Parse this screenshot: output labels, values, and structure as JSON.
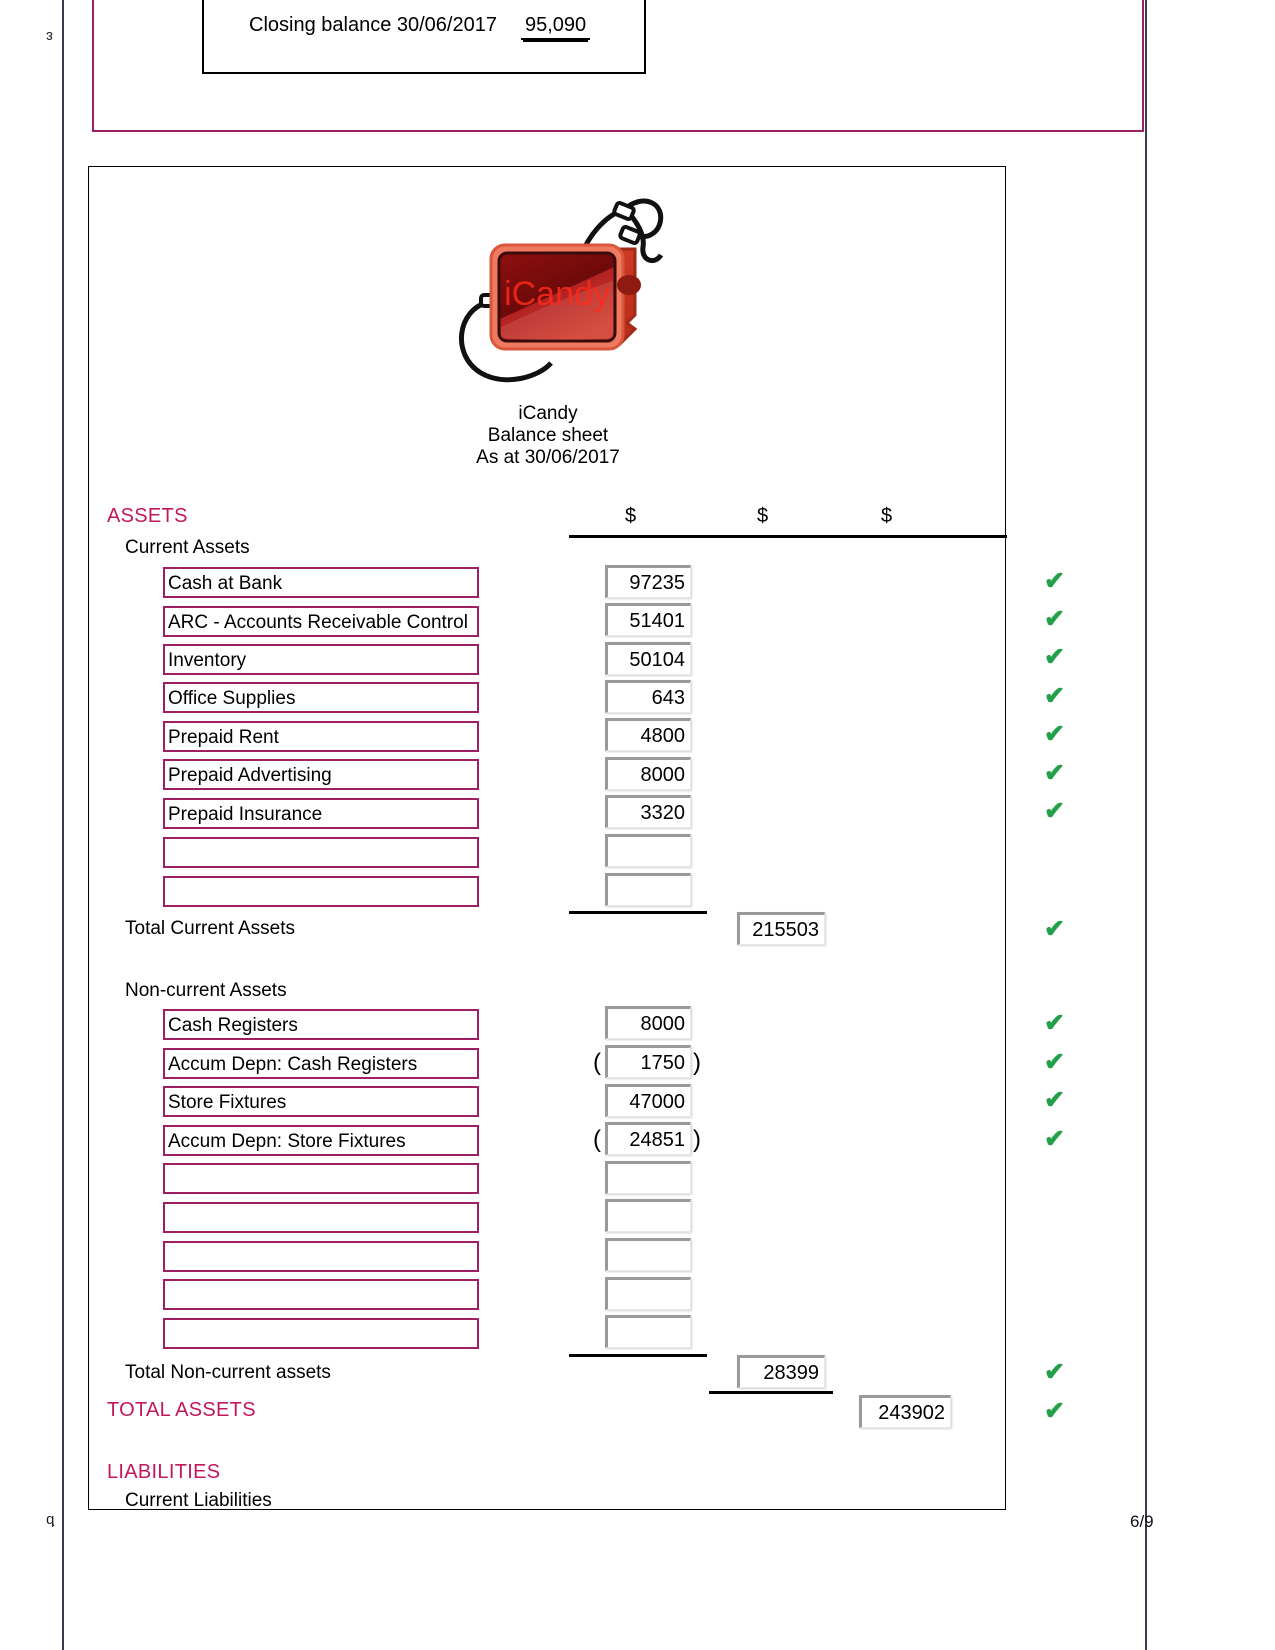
{
  "margin_marks": {
    "top": "ɛ",
    "bottom": "ƅ"
  },
  "page_number": "6/9",
  "previous_statement": {
    "closing_label": "Closing balance 30/06/2017",
    "closing_amount": "95,090"
  },
  "logo": {
    "brand_text": "iCandy",
    "icon": "mp3-player-with-earphones"
  },
  "title": {
    "company": "iCandy",
    "statement": "Balance sheet",
    "as_at": "As at 30/06/2017"
  },
  "column_headers": [
    "$",
    "$",
    "$"
  ],
  "sections": {
    "assets_heading": "ASSETS",
    "current_assets_heading": "Current Assets",
    "current_assets": [
      {
        "label": "Cash at Bank",
        "value": "97235",
        "negative": false,
        "checked": true
      },
      {
        "label": "ARC - Accounts Receivable Control",
        "value": "51401",
        "negative": false,
        "checked": true
      },
      {
        "label": "Inventory",
        "value": "50104",
        "negative": false,
        "checked": true
      },
      {
        "label": "Office Supplies",
        "value": "643",
        "negative": false,
        "checked": true
      },
      {
        "label": "Prepaid Rent",
        "value": "4800",
        "negative": false,
        "checked": true
      },
      {
        "label": "Prepaid Advertising",
        "value": "8000",
        "negative": false,
        "checked": true
      },
      {
        "label": "Prepaid Insurance",
        "value": "3320",
        "negative": false,
        "checked": true
      },
      {
        "label": "",
        "value": "",
        "negative": false,
        "checked": false
      },
      {
        "label": "",
        "value": "",
        "negative": false,
        "checked": false
      }
    ],
    "total_current_assets": {
      "label": "Total Current Assets",
      "value": "215503",
      "checked": true
    },
    "non_current_assets_heading": "Non-current Assets",
    "non_current_assets": [
      {
        "label": "Cash Registers",
        "value": "8000",
        "negative": false,
        "checked": true
      },
      {
        "label": "Accum Depn: Cash Registers",
        "value": "1750",
        "negative": true,
        "checked": true
      },
      {
        "label": "Store Fixtures",
        "value": "47000",
        "negative": false,
        "checked": true
      },
      {
        "label": "Accum Depn: Store Fixtures",
        "value": "24851",
        "negative": true,
        "checked": true
      },
      {
        "label": "",
        "value": "",
        "negative": false,
        "checked": false
      },
      {
        "label": "",
        "value": "",
        "negative": false,
        "checked": false
      },
      {
        "label": "",
        "value": "",
        "negative": false,
        "checked": false
      },
      {
        "label": "",
        "value": "",
        "negative": false,
        "checked": false
      },
      {
        "label": "",
        "value": "",
        "negative": false,
        "checked": false
      }
    ],
    "total_non_current_assets": {
      "label": "Total Non-current assets",
      "value": "28399",
      "checked": true
    },
    "total_assets": {
      "label": "TOTAL ASSETS",
      "value": "243902",
      "checked": true
    },
    "liabilities_heading": "LIABILITIES",
    "current_liabilities_heading": "Current Liabilities"
  },
  "icons": {
    "check": "✔"
  },
  "colors": {
    "accent": "#c2185b",
    "box_border": "#9e1f63",
    "check": "#22a04a"
  }
}
